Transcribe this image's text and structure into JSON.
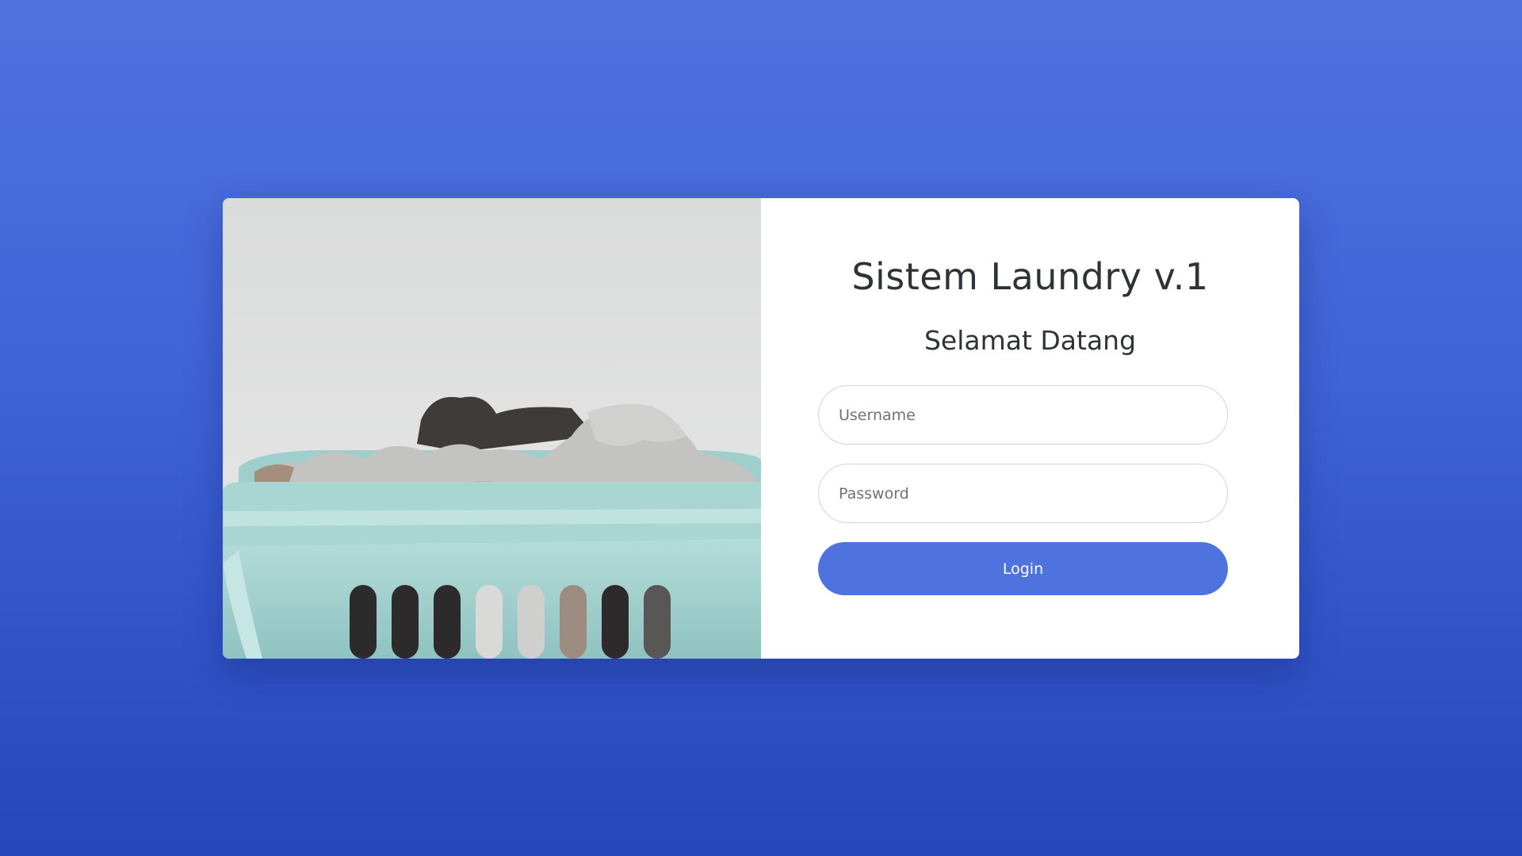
{
  "app": {
    "title": "Sistem Laundry v.1",
    "welcome": "Selamat Datang"
  },
  "form": {
    "username_placeholder": "Username",
    "password_placeholder": "Password",
    "username_value": "",
    "password_value": "",
    "login_label": "Login"
  },
  "image": {
    "subject": "laundry-basket-photo"
  },
  "colors": {
    "background_top": "#4e73df",
    "background_bottom": "#2446b9",
    "primary": "#4e73df",
    "card": "#ffffff",
    "text": "#2f3237",
    "placeholder": "#6e707e",
    "input_border": "#d1d3e2",
    "basket": "#a6d3d0"
  }
}
